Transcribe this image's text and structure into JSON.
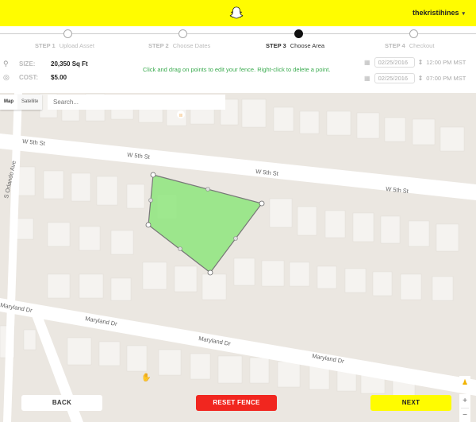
{
  "header": {
    "logo_icon": "snapchat-ghost-icon",
    "username": "thekristihines",
    "caret": "▾"
  },
  "steps": [
    {
      "num": "STEP 1",
      "label": "Upload Asset",
      "active": false
    },
    {
      "num": "STEP 2",
      "label": "Choose Dates",
      "active": false
    },
    {
      "num": "STEP 3",
      "label": "Choose Area",
      "active": true
    },
    {
      "num": "STEP 4",
      "label": "Checkout",
      "active": false
    }
  ],
  "info": {
    "size_label": "SIZE:",
    "size_value": "20,350 Sq Ft",
    "cost_label": "COST:",
    "cost_value": "$5.00",
    "hint": "Click and drag on points to edit your fence. Right-click to delete a point.",
    "start_date": "02/25/2016",
    "start_time": "12:00 PM MST",
    "end_date": "02/25/2016",
    "end_time": "07:00 PM MST"
  },
  "map": {
    "type_map": "Map",
    "type_satellite": "Satellite",
    "search_placeholder": "Search...",
    "streets": {
      "w5th_1": "W 5th St",
      "w5th_2": "W 5th St",
      "w5th_3": "W 5th St",
      "w5th_4": "W 5th St",
      "orlando": "S Orlando Ave",
      "maryland_1": "Maryland Dr",
      "maryland_2": "Maryland Dr",
      "maryland_3": "Maryland Dr",
      "maryland_4": "Maryland Dr"
    },
    "fence_color": "#8ee57c"
  },
  "buttons": {
    "back": "BACK",
    "reset": "RESET FENCE",
    "next": "NEXT",
    "zoom_in": "+",
    "zoom_out": "−"
  }
}
